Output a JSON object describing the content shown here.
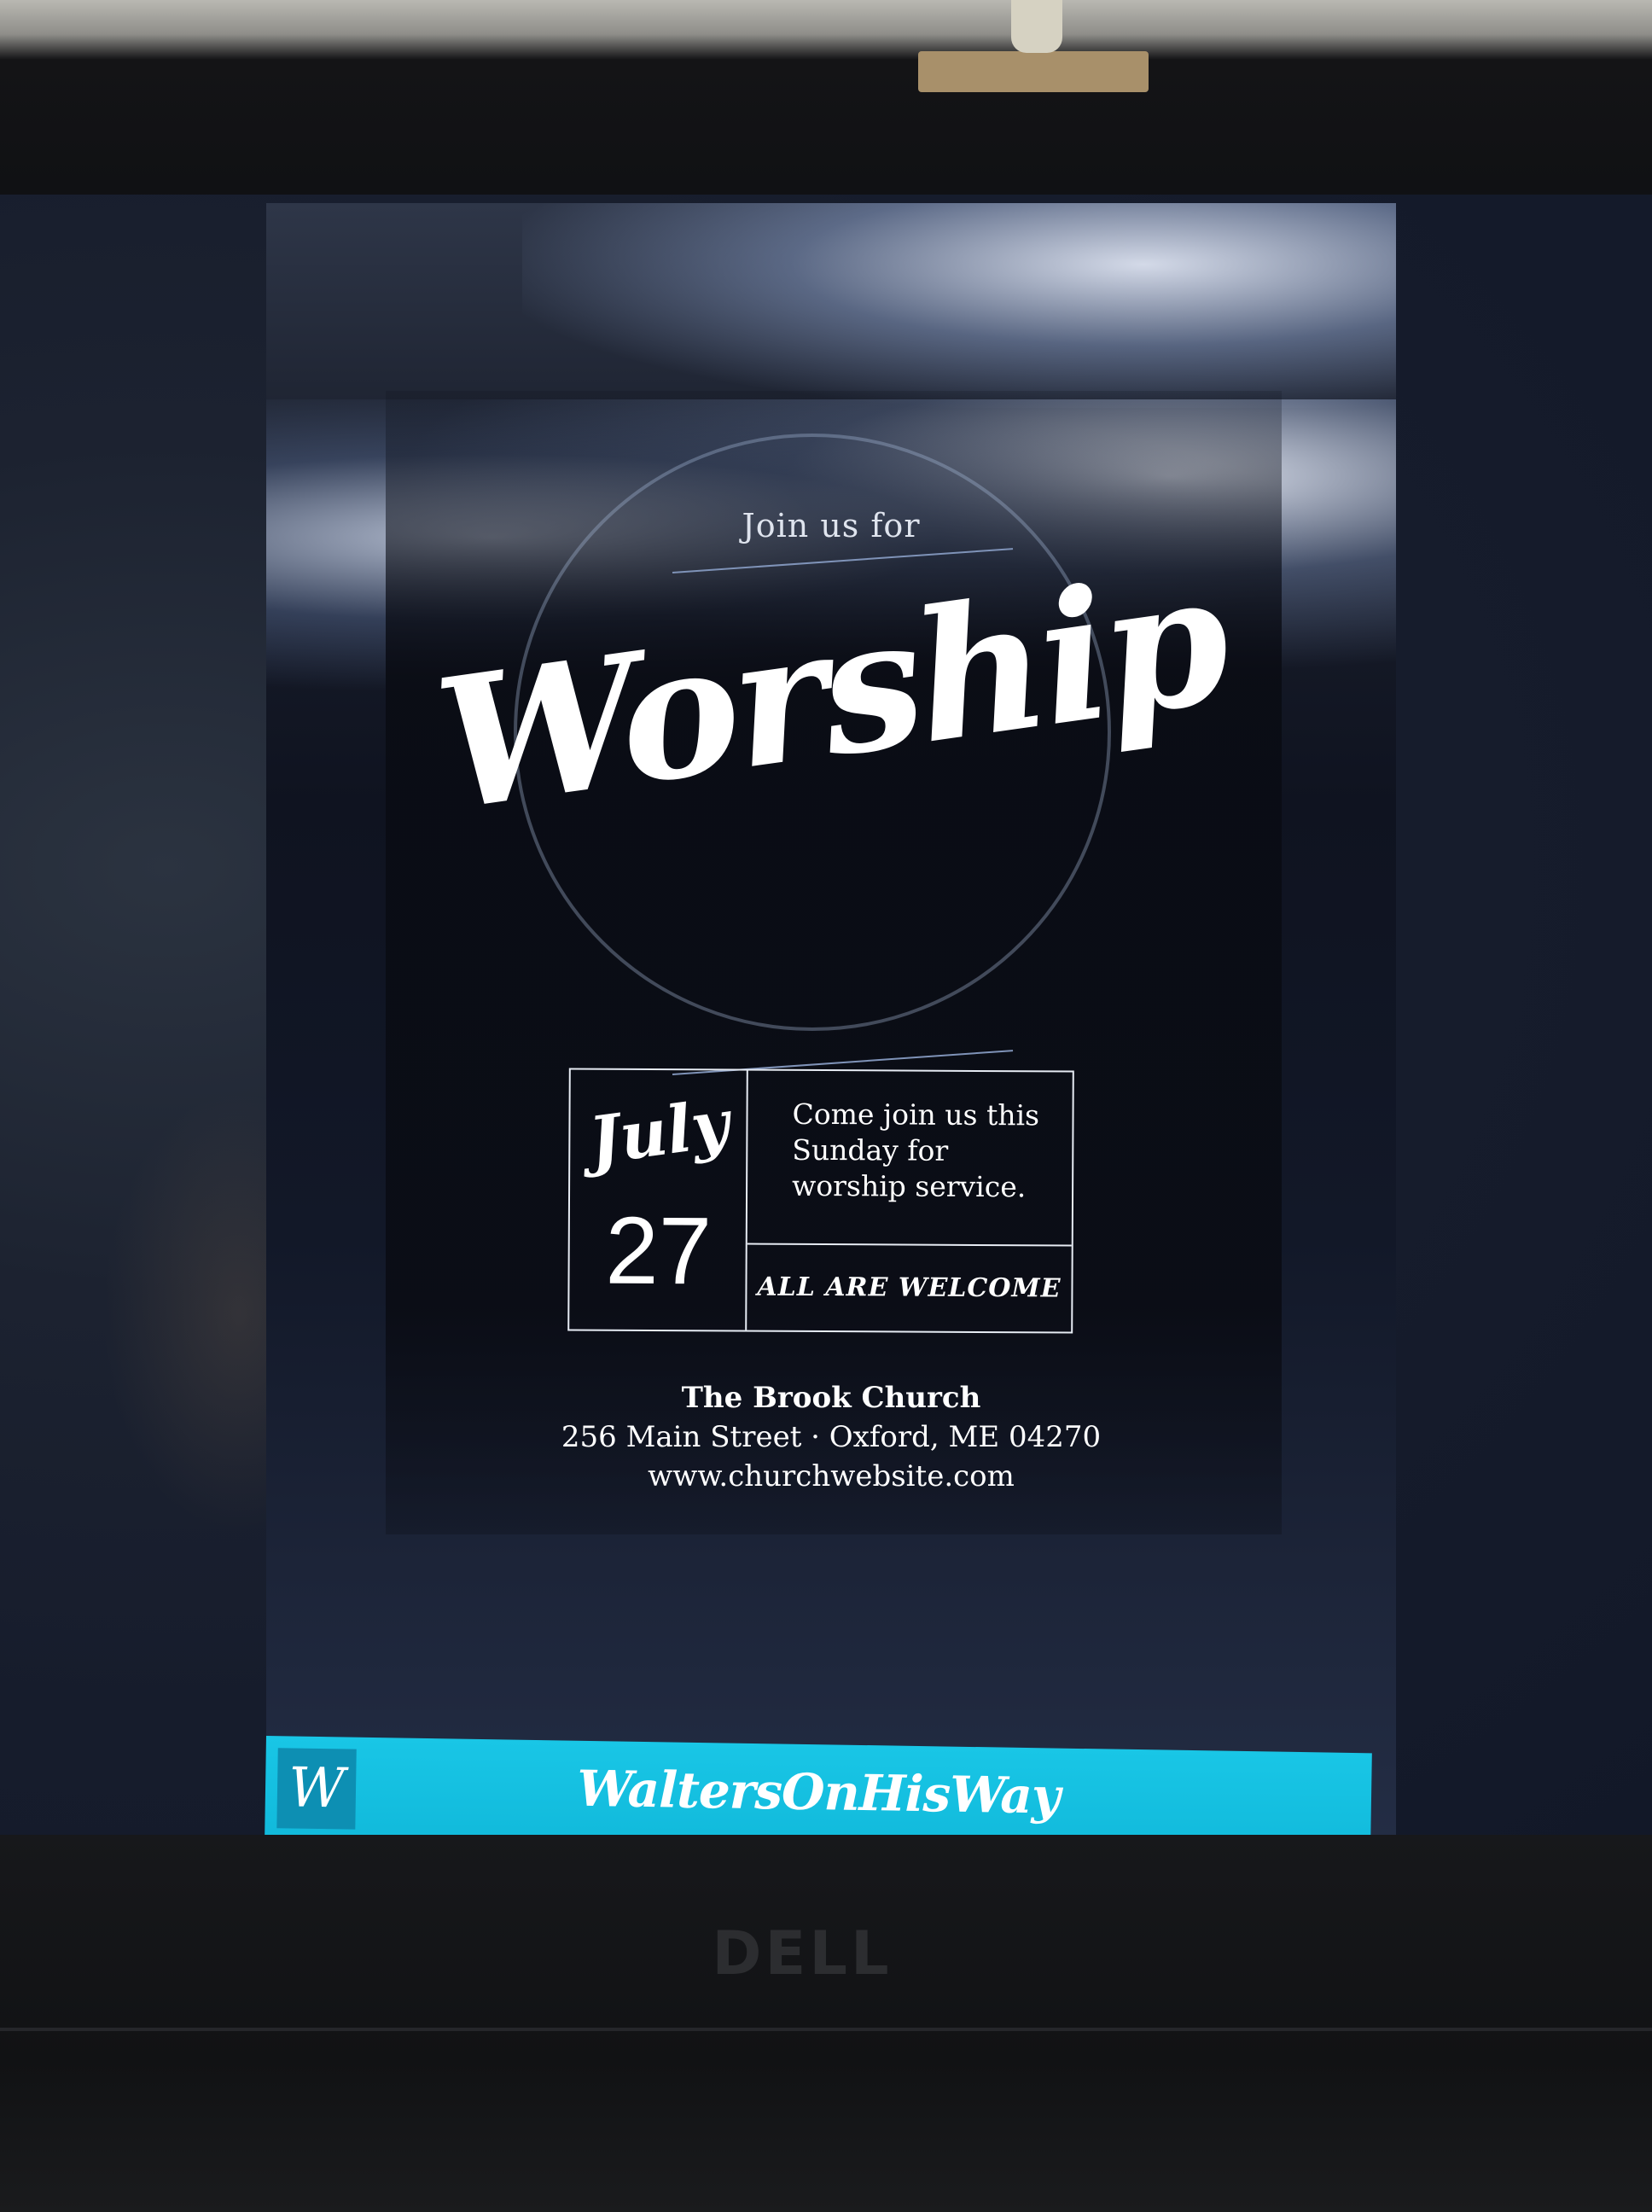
{
  "flyer": {
    "intro": "Join us for",
    "title": "Worship",
    "date": {
      "month": "July",
      "day": "27"
    },
    "details": {
      "line1": "Come join us this",
      "line2": "Sunday for",
      "line3": "worship service.",
      "welcome": "ALL ARE WELCOME"
    },
    "church": {
      "name": "The Brook Church",
      "address": "256 Main Street · Oxford, ME 04270",
      "website": "www.churchwebsite.com"
    }
  },
  "banner": {
    "logo": "W",
    "text": "WaltersOnHisWay",
    "color": "#19c6e6"
  },
  "device": {
    "brand": "DELL"
  }
}
